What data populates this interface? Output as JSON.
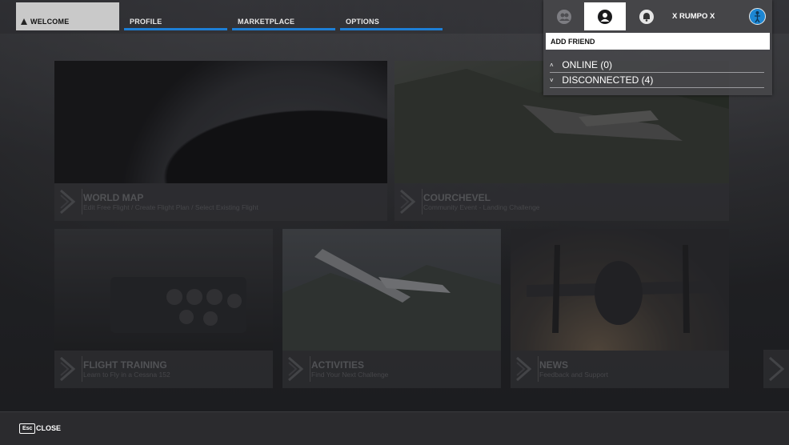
{
  "nav": {
    "tabs": [
      {
        "label": "WELCOME",
        "active": true
      },
      {
        "label": "PROFILE",
        "active": false
      },
      {
        "label": "MARKETPLACE",
        "active": false
      },
      {
        "label": "OPTIONS",
        "active": false
      }
    ]
  },
  "cards": [
    {
      "title": "WORLD MAP",
      "subtitle": "Edit Free Flight / Create Flight Plan / Select Existing Flight"
    },
    {
      "title": "COURCHEVEL",
      "subtitle": "Community Event - Landing Challenge"
    },
    {
      "title": "FLIGHT TRAINING",
      "subtitle": "Learn to Fly in a Cessna 152"
    },
    {
      "title": "ACTIVITIES",
      "subtitle": "Find Your Next Challenge"
    },
    {
      "title": "NEWS",
      "subtitle": "Feedback and Support"
    }
  ],
  "friends_panel": {
    "username": "X RUMPO X",
    "add_friend": "ADD FRIEND",
    "groups": [
      {
        "label": "ONLINE (0)",
        "arrow": "˄"
      },
      {
        "label": "DISCONNECTED (4)",
        "arrow": "˅"
      }
    ],
    "icons": [
      "group-icon",
      "person-icon",
      "notification-bell-icon"
    ],
    "avatar_color": "#1d86d2"
  },
  "footer": {
    "key": "Esc",
    "label": "CLOSE"
  },
  "colors": {
    "accent": "#1d7fd6"
  }
}
